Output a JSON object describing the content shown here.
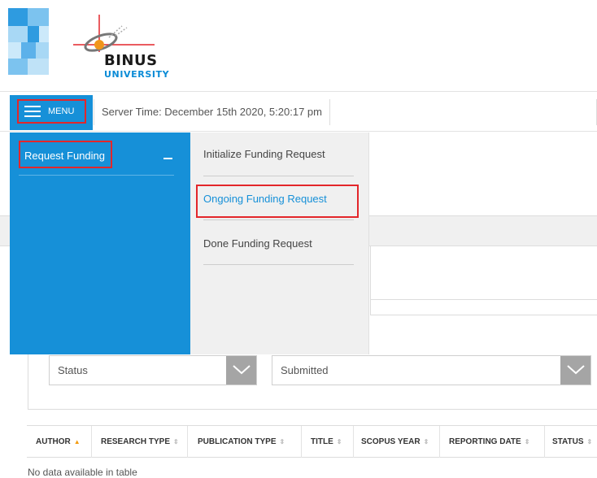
{
  "brand": {
    "logo_name": "BINUS",
    "logo_sub": "UNIVERSITY"
  },
  "topbar": {
    "menu_label": "MENU",
    "server_time": "Server Time: December 15th 2020, 5:20:17 pm"
  },
  "side_menu": {
    "active_item": {
      "label": "Request Funding",
      "expanded_icon": "minus-icon"
    }
  },
  "sub_menu": {
    "items": [
      {
        "label": "Initialize Funding Request",
        "active": false
      },
      {
        "label": "Ongoing Funding Request",
        "active": true
      },
      {
        "label": "Done Funding Request",
        "active": false
      }
    ]
  },
  "filters": {
    "status_label": "Status",
    "status_value": "Submitted"
  },
  "table": {
    "columns": [
      "AUTHOR",
      "RESEARCH TYPE",
      "PUBLICATION TYPE",
      "TITLE",
      "SCOPUS YEAR",
      "REPORTING DATE",
      "STATUS"
    ],
    "sorted_column": "AUTHOR",
    "empty_text": "No data available in table"
  },
  "colors": {
    "accent": "#1690d8",
    "highlight": "#e3262a",
    "sort_active": "#f39c12",
    "submenu_bg": "#f0f0f0"
  }
}
